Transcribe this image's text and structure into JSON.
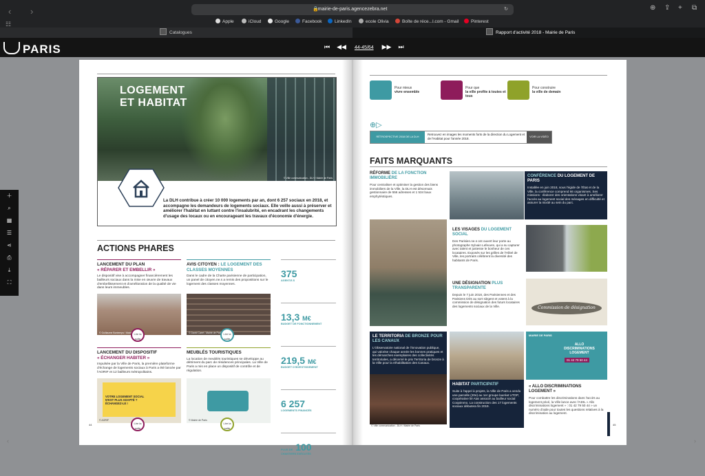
{
  "browser": {
    "url": "mairie-de-paris.agencezebra.net",
    "bookmarks": [
      {
        "label": "Apple",
        "color": "#dddddd"
      },
      {
        "label": "iCloud",
        "color": "#bbbbbb"
      },
      {
        "label": "Google",
        "color": "#e8e8e8"
      },
      {
        "label": "Facebook",
        "color": "#3b5998"
      },
      {
        "label": "LinkedIn",
        "color": "#0a66c2"
      },
      {
        "label": "ecole Olivia",
        "color": "#aaaaaa"
      },
      {
        "label": "Boîte de réce...l.com - Gmail",
        "color": "#d44638"
      },
      {
        "label": "Pinterest",
        "color": "#e60023"
      }
    ],
    "tabs": [
      {
        "label": "Catalogues"
      },
      {
        "label": "Rapport d'activité 2018 - Mairie de Paris"
      }
    ]
  },
  "viewer": {
    "logo": "PARIS",
    "page_indicator": "44-45/64"
  },
  "left_page": {
    "hero_title_1": "LOGEMENT",
    "hero_title_2": "ET HABITAT",
    "hero_credit": "© Ville communication - DLH / Mairie de Paris",
    "hero_text": "La DLH contribue à créer 10 000 logements par an, dont 6 257 sociaux en 2018, et accompagne les demandeurs de logements sociaux. Elle veille aussi à préserver et améliorer l'habitat en luttant contre l'insalubrité, en encadrant les changements d'usage des locaux ou en encourageant les travaux d'économie d'énergie.",
    "actions_title": "ACTIONS PHARES",
    "actions": [
      {
        "title": "LANCEMENT DU PLAN",
        "accent": "« RÉPARER ET EMBELLIR »",
        "body": "Le dispositif vise à accompagner financièrement les bailleurs sociaux dans la mise en œuvre de travaux d'embellissement et d'amélioration de la qualité de vie dans leurs immeubles.",
        "credit": "© Guillaume Bontemps / Mairie de Paris"
      },
      {
        "title": "AVIS CITOYEN :",
        "accent": "LE LOGEMENT DES CLASSES MOYENNES",
        "body": "Dans le cadre de la Charte parisienne de participation, un panel de citoyen.ne.s a remis des propositions sur le logement des classes moyennes.",
        "credit": "© David Carré / Mairie de Paris"
      },
      {
        "title": "LANCEMENT DU DISPOSITIF",
        "accent": "« ÉCHANGER HABITER »",
        "body": "Impulsée par la Ville de Paris, la première plateforme d'échange de logements sociaux à Paris a été lancée par l'AORIF et 12 bailleurs métropolitains.",
        "credit": "© AORIF",
        "poster": "VOTRE LOGEMENT SOCIAL N'EST PLUS ADAPTÉ ? ÉCHANGEZ-LE !"
      },
      {
        "title": "MEUBLÉS TOURISTIQUES",
        "accent": "",
        "body": "La location de meublés touristiques se développe au détriment du parc de résidences principales. La Ville de Paris a mis en place un dispositif de contrôle et de régulation.",
        "credit": "© Mairie de Paris"
      }
    ],
    "lire_label": "Lire la suite",
    "stats": [
      {
        "num": "375",
        "unit": "",
        "label": "AGENT.E.S"
      },
      {
        "num": "13,3",
        "unit": "M€",
        "label": "BUDGET DE FONCTIONNEMENT"
      },
      {
        "num": "219,5",
        "unit": "M€",
        "label": "BUDGET D'INVESTISSEMENT"
      },
      {
        "num": "6 257",
        "unit": "",
        "label": "LOGEMENTS FINANCÉS"
      },
      {
        "num": "100",
        "prefix": "PLUS DE",
        "unit": "",
        "label": "CHANTIERS EXÉCUTÉS"
      }
    ],
    "page_number": "44"
  },
  "right_page": {
    "icons": [
      {
        "line1": "Pour mieux",
        "line2": "vivre ensemble",
        "color": "#3e9aa3"
      },
      {
        "line1": "Pour que",
        "line2": "la ville profite à toutes et tous",
        "color": "#8e1c5b"
      },
      {
        "line1": "Pour construire",
        "line2": "la ville de demain",
        "color": "#8fa22a"
      }
    ],
    "video_left": "RÉTROSPECTIVE 2018 DE LA DLH",
    "video_mid": "Retrouvez en images les moments forts de la direction du Logement et de l'Habitat pour l'année 2018.",
    "video_right": "VOIR LA VIDÉO",
    "faits_title": "FAITS MARQUANTS",
    "cards": {
      "reforme": {
        "title": "RÉFORME",
        "accent": "DE LA FONCTION IMMOBILIÈRE",
        "body": "Pour centraliser et optimiser la gestion des biens immobiliers de la Ville, la DLH est désormais gestionnaire de 556 adresses et 1 534 baux emphytéotiques."
      },
      "conference": {
        "title": "CONFÉRENCE",
        "accent": "DU LOGEMENT DE PARIS",
        "body": "Installée en juin 2018, sous l'égide de l'État et de la Ville, la conférence comprend 66 organismes. Ses missions : élaborer des orientations visant à améliorer l'accès au logement social des ménages en difficulté et assurer la mixité au sein du parc."
      },
      "visages": {
        "title": "LES VISAGES",
        "accent": "DU LOGEMENT SOCIAL",
        "body": "Des Parisien.ne.s ont ouvert leur porte au photographe Sylvain Lefeuvre, qui a su capturer avec talent et justesse le bonheur de ces locataires. Exposés sur les grilles de l'Hôtel de Ville, les portraits célèbrent la diversité des habitants de Paris."
      },
      "designation": {
        "title": "UNE DÉSIGNATION",
        "accent": "PLUS TRANSPARENTE",
        "body": "Depuis le 7 juin 2018, des Parisiennes et des Parisiens tirés au sort siègent et votent à la commission de désignation des futurs locataires des logements sociaux de la Ville.",
        "image_text": "Commission de désignation"
      },
      "territoria": {
        "title": "LE TERRITORIA",
        "accent": "DE BRONZE POUR LES CANAUX",
        "body": "L'Observatoire national de l'innovation publique, qui valorise chaque année les bonnes pratiques et les démarches exemplaires des collectivités territoriales, a décerné le prix Territoria de bronze à la Ville pour la réhabilitation des Canaux."
      },
      "habitat": {
        "title": "HABITAT",
        "accent": "PARTICIPATIF",
        "body": "Suite à l'appel à projets, la Ville de Paris a vendu une parcelle (20e) au 1er groupe lauréat UTOP, coopérative lié Atar associé au bailleur social Coopimmo. La construction des 17 logements sociaux débutera fin 2019."
      },
      "discriminations": {
        "title": "« ALLO DISCRIMINATIONS LOGEMENT »",
        "accent": "",
        "body": "Pour combattre les discriminations dans l'accès au logement privé, la Ville lance avec l'ADIL « Allo discriminations logement » : 01 42 79 50 44 » un numéro d'aide pour toutes les questions relatives à la discrimination au logement.",
        "poster_header": "MAIRIE DE PARIS",
        "poster_text": "ALLO DISCRIMINATIONS LOGEMENT",
        "poster_phone": "01 42 79 50 44"
      }
    },
    "credit": "© Ville communication - DLH / Mairie de Paris",
    "page_number": "45"
  }
}
